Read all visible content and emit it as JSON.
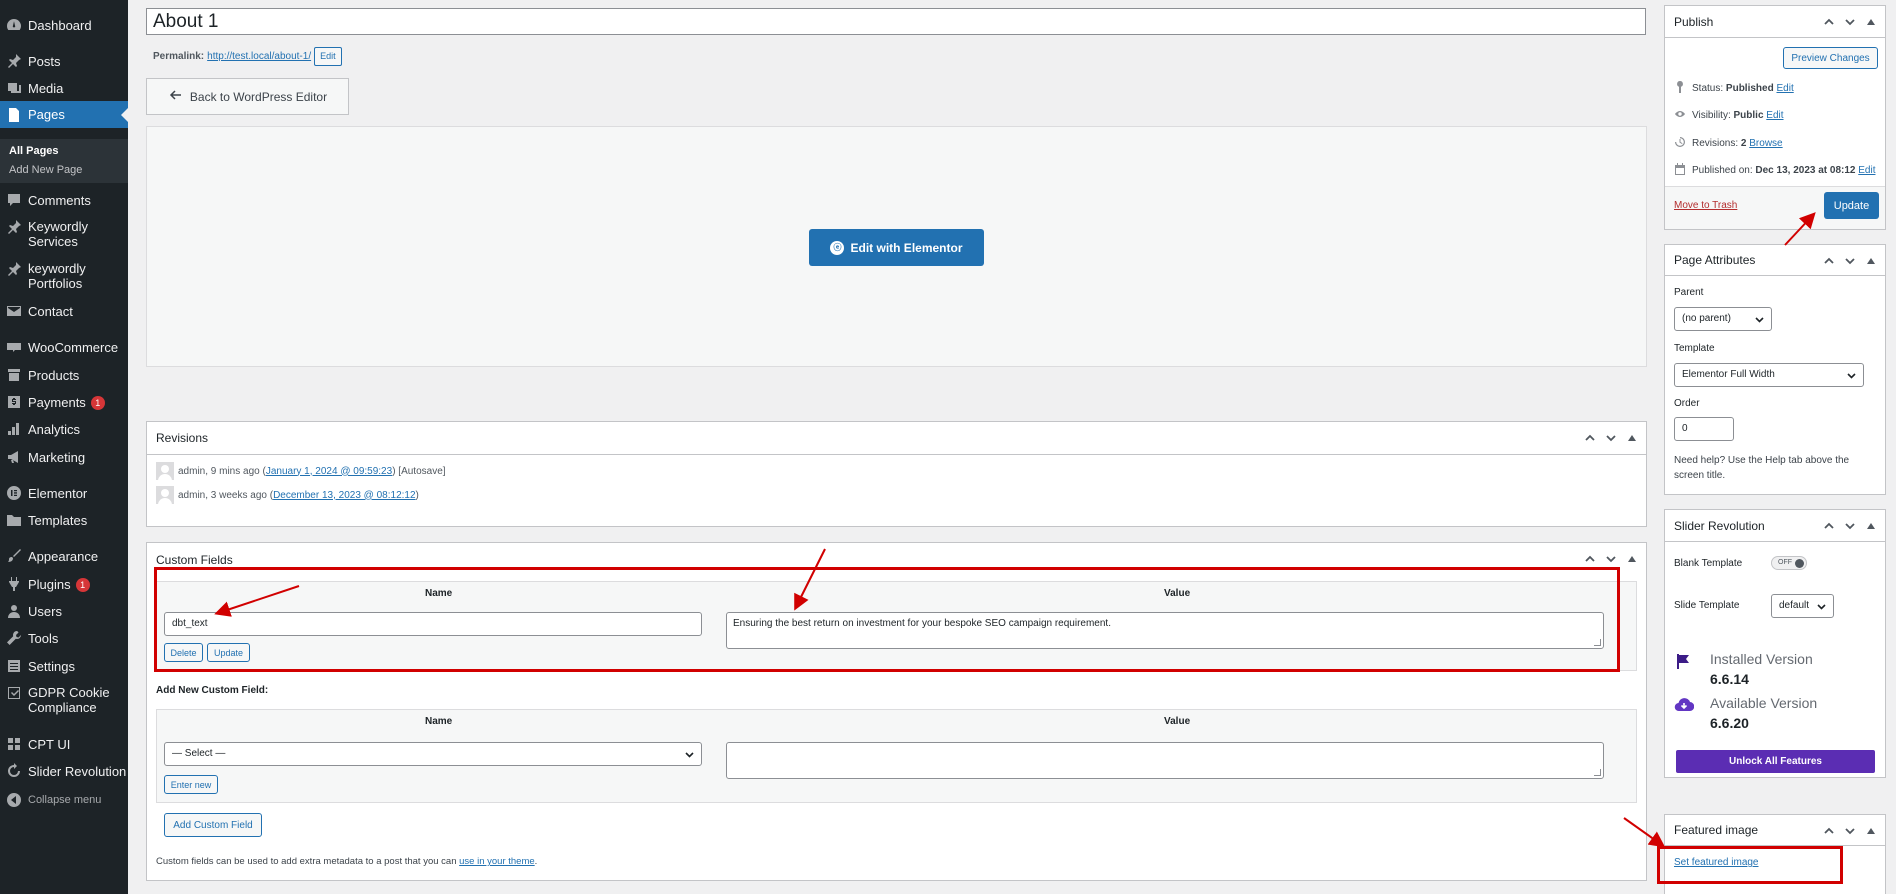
{
  "sidebar": {
    "items": [
      {
        "id": "dashboard",
        "label": "Dashboard",
        "icon": "dashboard-icon"
      },
      {
        "id": "posts",
        "label": "Posts",
        "icon": "pin-icon"
      },
      {
        "id": "media",
        "label": "Media",
        "icon": "media-icon"
      },
      {
        "id": "pages",
        "label": "Pages",
        "icon": "page-icon"
      },
      {
        "id": "comments",
        "label": "Comments",
        "icon": "comment-icon"
      },
      {
        "id": "keywordly-services",
        "label": "Keywordly Services",
        "icon": "pin-icon"
      },
      {
        "id": "keywordly-portfolios",
        "label": "keywordly Portfolios",
        "icon": "pin-icon"
      },
      {
        "id": "contact",
        "label": "Contact",
        "icon": "mail-icon"
      },
      {
        "id": "woocommerce",
        "label": "WooCommerce",
        "icon": "woo-icon"
      },
      {
        "id": "products",
        "label": "Products",
        "icon": "archive-icon"
      },
      {
        "id": "payments",
        "label": "Payments",
        "icon": "dollar-icon",
        "badge": "1"
      },
      {
        "id": "analytics",
        "label": "Analytics",
        "icon": "bar-chart-icon"
      },
      {
        "id": "marketing",
        "label": "Marketing",
        "icon": "megaphone-icon"
      },
      {
        "id": "elementor",
        "label": "Elementor",
        "icon": "elementor-icon"
      },
      {
        "id": "templates",
        "label": "Templates",
        "icon": "folder-icon"
      },
      {
        "id": "appearance",
        "label": "Appearance",
        "icon": "brush-icon"
      },
      {
        "id": "plugins",
        "label": "Plugins",
        "icon": "plugin-icon",
        "badge": "1"
      },
      {
        "id": "users",
        "label": "Users",
        "icon": "user-icon"
      },
      {
        "id": "tools",
        "label": "Tools",
        "icon": "wrench-icon"
      },
      {
        "id": "settings",
        "label": "Settings",
        "icon": "settings-icon"
      },
      {
        "id": "gdpr",
        "label": "GDPR Cookie Compliance",
        "icon": "check-icon"
      },
      {
        "id": "cpt-ui",
        "label": "CPT UI",
        "icon": "grid-icon"
      },
      {
        "id": "slider-revolution",
        "label": "Slider Revolution",
        "icon": "refresh-icon"
      }
    ],
    "submenu": [
      "All Pages",
      "Add New Page"
    ],
    "collapse": "Collapse menu"
  },
  "editor": {
    "title": "About 1",
    "permalink_label": "Permalink:",
    "permalink_url": "http://test.local/about-1/",
    "permalink_edit": "Edit",
    "back_button": "Back to WordPress Editor",
    "elementor_button": "Edit with Elementor"
  },
  "revisions": {
    "title": "Revisions",
    "rows": [
      {
        "prefix": "admin, 9 mins ago (",
        "link": "January 1, 2024 @ 09:59:23",
        "suffix": ") [Autosave]"
      },
      {
        "prefix": "admin, 3 weeks ago (",
        "link": "December 13, 2023 @ 08:12:12",
        "suffix": ")"
      }
    ]
  },
  "custom_fields": {
    "title": "Custom Fields",
    "col_name": "Name",
    "col_value": "Value",
    "existing": {
      "name": "dbt_text",
      "value": "Ensuring the best return on investment for your bespoke SEO campaign requirement."
    },
    "delete_button": "Delete",
    "update_button": "Update",
    "add_new_label": "Add New Custom Field:",
    "select_placeholder": "— Select —",
    "enter_new_button": "Enter new",
    "add_button": "Add Custom Field",
    "footer_text": "Custom fields can be used to add extra metadata to a post that you can ",
    "footer_link": "use in your theme",
    "footer_end": "."
  },
  "publish": {
    "title": "Publish",
    "preview_button": "Preview Changes",
    "status_label": "Status:",
    "status_value": "Published",
    "visibility_label": "Visibility:",
    "visibility_value": "Public",
    "revisions_label": "Revisions:",
    "revisions_value": "2",
    "browse_link": "Browse",
    "published_label": "Published on:",
    "published_value": "Dec 13, 2023 at 08:12",
    "edit_link": "Edit",
    "trash_link": "Move to Trash",
    "update_button": "Update"
  },
  "page_attributes": {
    "title": "Page Attributes",
    "parent_label": "Parent",
    "parent_value": "(no parent)",
    "template_label": "Template",
    "template_value": "Elementor Full Width",
    "order_label": "Order",
    "order_value": "0",
    "help_text": "Need help? Use the Help tab above the screen title."
  },
  "slider_revolution": {
    "title": "Slider Revolution",
    "blank_label": "Blank Template",
    "toggle_value": "OFF",
    "slide_label": "Slide Template",
    "slide_value": "default",
    "installed_label": "Installed Version",
    "installed_value": "6.6.14",
    "available_label": "Available Version",
    "available_value": "6.6.20",
    "unlock_button": "Unlock All Features"
  },
  "featured_image": {
    "title": "Featured image",
    "link": "Set featured image"
  },
  "colors": {
    "accent": "#2271b1",
    "sidebar_bg": "#1d2327",
    "annotation": "#d10000",
    "unlock": "#5b2db3"
  }
}
